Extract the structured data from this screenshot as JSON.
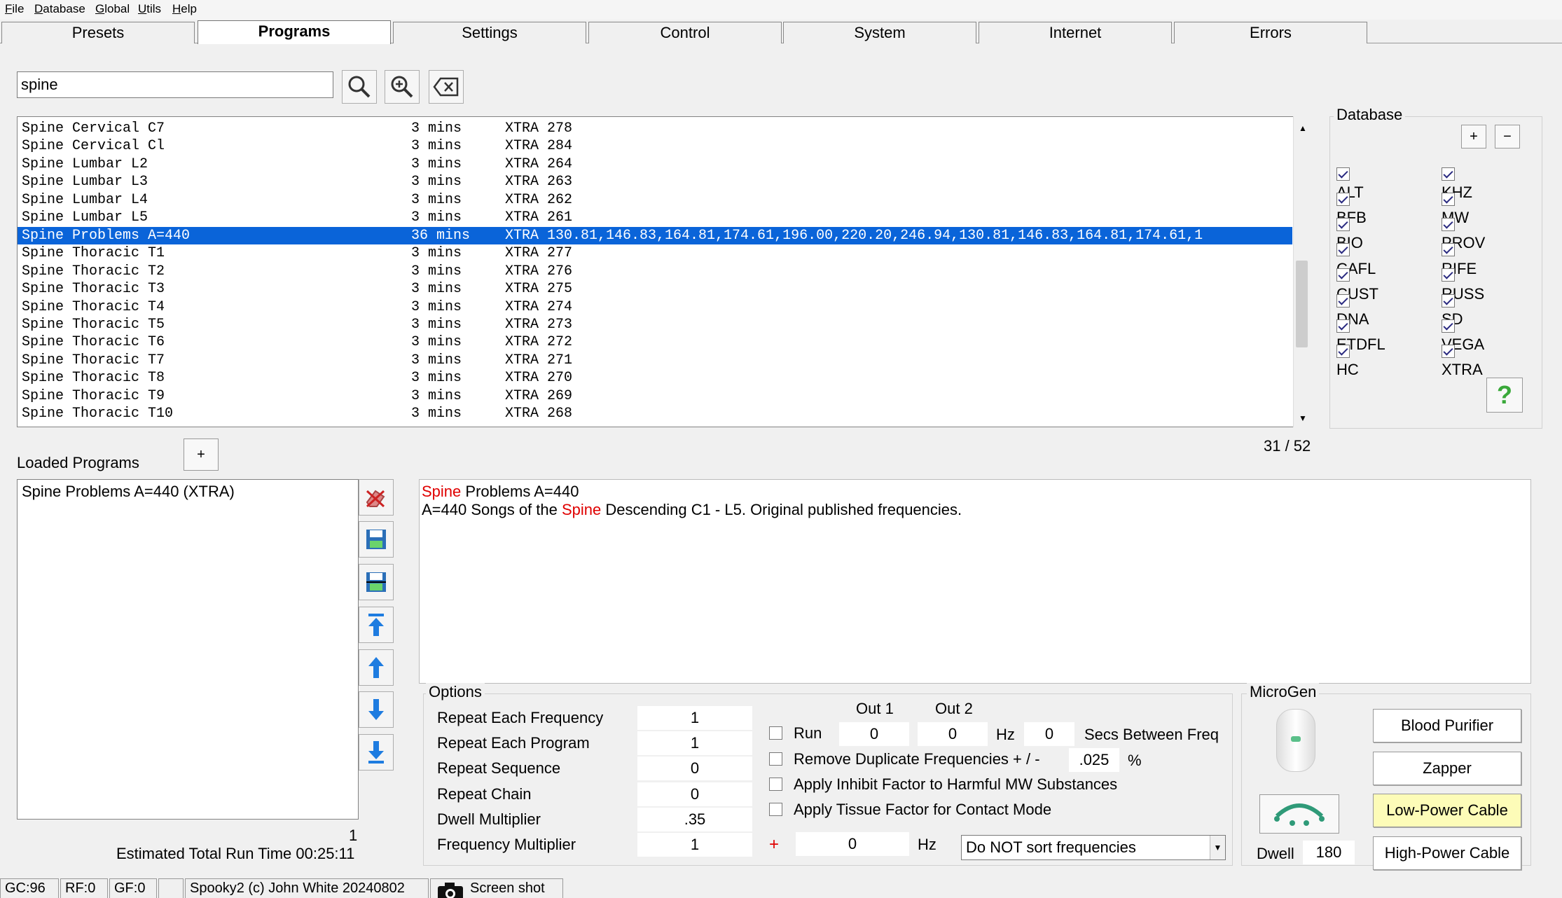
{
  "menu": [
    "File",
    "Database",
    "Global",
    "Utils",
    "Help"
  ],
  "tabs": [
    "Presets",
    "Programs",
    "Settings",
    "Control",
    "System",
    "Internet",
    "Errors"
  ],
  "active_tab": "Programs",
  "search": {
    "value": "spine"
  },
  "programs": [
    {
      "name": "Spine Cervical C7",
      "time": "3 mins",
      "freqs": "XTRA 278"
    },
    {
      "name": "Spine Cervical Cl",
      "time": "3 mins",
      "freqs": "XTRA 284"
    },
    {
      "name": "Spine Lumbar L2",
      "time": "3 mins",
      "freqs": "XTRA 264"
    },
    {
      "name": "Spine Lumbar L3",
      "time": "3 mins",
      "freqs": "XTRA 263"
    },
    {
      "name": "Spine Lumbar L4",
      "time": "3 mins",
      "freqs": "XTRA 262"
    },
    {
      "name": "Spine Lumbar L5",
      "time": "3 mins",
      "freqs": "XTRA 261"
    },
    {
      "name": "Spine Problems A=440",
      "time": "36 mins",
      "freqs": "XTRA 130.81,146.83,164.81,174.61,196.00,220.20,246.94,130.81,146.83,164.81,174.61,1"
    },
    {
      "name": "Spine Thoracic T1",
      "time": "3 mins",
      "freqs": "XTRA 277"
    },
    {
      "name": "Spine Thoracic T2",
      "time": "3 mins",
      "freqs": "XTRA 276"
    },
    {
      "name": "Spine Thoracic T3",
      "time": "3 mins",
      "freqs": "XTRA 275"
    },
    {
      "name": "Spine Thoracic T4",
      "time": "3 mins",
      "freqs": "XTRA 274"
    },
    {
      "name": "Spine Thoracic T5",
      "time": "3 mins",
      "freqs": "XTRA 273"
    },
    {
      "name": "Spine Thoracic T6",
      "time": "3 mins",
      "freqs": "XTRA 272"
    },
    {
      "name": "Spine Thoracic T7",
      "time": "3 mins",
      "freqs": "XTRA 271"
    },
    {
      "name": "Spine Thoracic T8",
      "time": "3 mins",
      "freqs": "XTRA 270"
    },
    {
      "name": "Spine Thoracic T9",
      "time": "3 mins",
      "freqs": "XTRA 269"
    },
    {
      "name": "Spine Thoracic T10",
      "time": "3 mins",
      "freqs": "XTRA 268"
    }
  ],
  "selected_program": "Spine Problems A=440",
  "database": {
    "title": "Database",
    "plus": "+",
    "minus": "−",
    "help": "?",
    "col1": [
      "ALT",
      "BFB",
      "BIO",
      "CAFL",
      "CUST",
      "DNA",
      "ETDFL",
      "HC"
    ],
    "col2": [
      "KHZ",
      "MW",
      "PROV",
      "RIFE",
      "RUSS",
      "SD",
      "VEGA",
      "XTRA"
    ]
  },
  "count": "31 / 52",
  "loaded": {
    "title": "Loaded Programs",
    "add": "+",
    "items": [
      "Spine Problems A=440 (XTRA)"
    ],
    "count": "1",
    "runtime": "Estimated Total Run Time 00:25:11"
  },
  "description": {
    "line1_hl": "Spine",
    "line1_rest": " Problems A=440",
    "line2_a": "A=440 Songs of the ",
    "line2_hl": "Spine",
    "line2_b": " Descending C1 - L5. Original published frequencies."
  },
  "options": {
    "title": "Options",
    "rows": [
      {
        "label": "Repeat Each Frequency",
        "value": "1"
      },
      {
        "label": "Repeat Each Program",
        "value": "1"
      },
      {
        "label": "Repeat Sequence",
        "value": "0"
      },
      {
        "label": "Repeat Chain",
        "value": "0"
      },
      {
        "label": "Dwell Multiplier",
        "value": ".35"
      },
      {
        "label": "Frequency Multiplier",
        "value": "1"
      }
    ],
    "out1": "Out 1",
    "out2": "Out 2",
    "run": "Run",
    "run_out1": "0",
    "run_out2": "0",
    "hz": "Hz",
    "secs_val": "0",
    "secs_label": "Secs Between Freq",
    "remove_dup": "Remove Duplicate Frequencies + / -",
    "dup_val": ".025",
    "pct": "%",
    "inhibit": "Apply Inhibit Factor to Harmful MW Substances",
    "tissue": "Apply Tissue Factor for Contact Mode",
    "plus": "+",
    "offset_val": "0",
    "offset_hz": "Hz",
    "sort": "Do NOT sort frequencies"
  },
  "microgen": {
    "title": "MicroGen",
    "dwell_label": "Dwell",
    "dwell_val": "180",
    "buttons": [
      "Blood Purifier",
      "Zapper",
      "Low-Power Cable",
      "High-Power Cable"
    ]
  },
  "status": [
    "GC:96",
    "RF:0",
    "GF:0",
    "",
    "Spooky2 (c) John White 20240802",
    "Screen shot"
  ]
}
